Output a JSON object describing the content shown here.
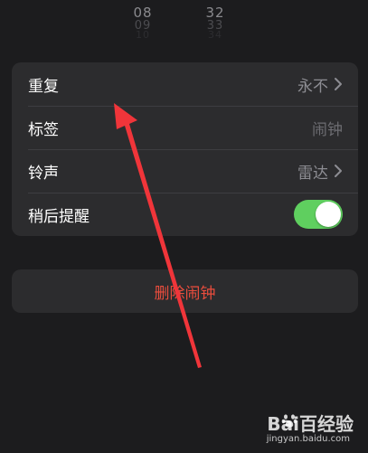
{
  "picker": {
    "hour_values": [
      "08",
      "09",
      "10"
    ],
    "minute_values": [
      "32",
      "33",
      "34"
    ]
  },
  "settings": {
    "repeat": {
      "label": "重复",
      "value": "永不"
    },
    "tag": {
      "label": "标签",
      "placeholder": "闹钟"
    },
    "ringtone": {
      "label": "铃声",
      "value": "雷达"
    },
    "snooze": {
      "label": "稍后提醒",
      "enabled": true
    }
  },
  "delete_button": {
    "label": "删除闹钟"
  },
  "watermark": {
    "brand": "Bai百经验",
    "url": "jingyan.baidu.com"
  },
  "colors": {
    "background": "#1c1c1e",
    "group_bg": "#2c2c2e",
    "toggle_on": "#5fcf5f",
    "destructive": "#eb4d3d",
    "annotation_arrow": "#f0353a"
  },
  "icons": [
    "chevron-right-icon",
    "annotation-arrow-icon",
    "baidu-paw-icon"
  ]
}
